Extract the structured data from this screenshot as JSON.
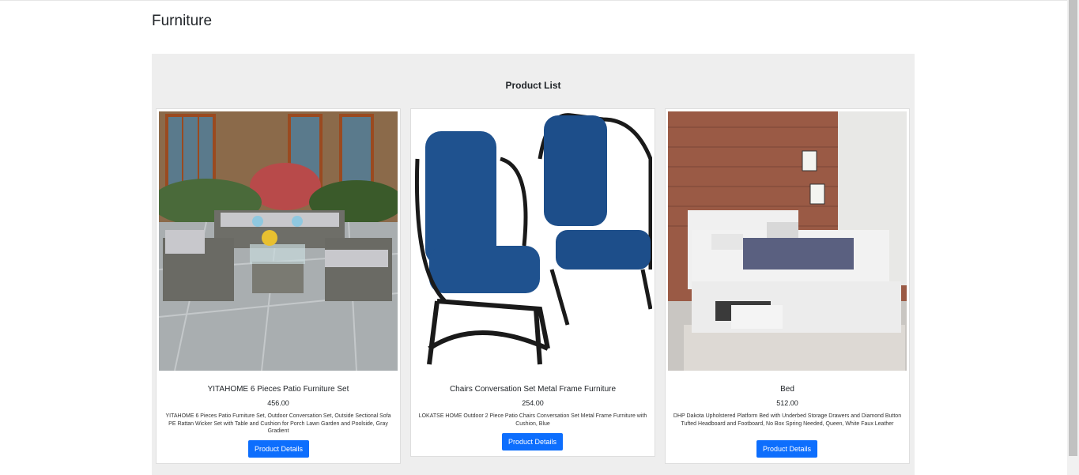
{
  "page": {
    "title": "Furniture"
  },
  "panel": {
    "title": "Product List"
  },
  "products": [
    {
      "name": "YITAHOME 6 Pieces Patio Furniture Set",
      "price": "456.00",
      "description": "YITAHOME 6 Pieces Patio Furniture Set, Outdoor Conversation Set, Outside Sectional Sofa PE Rattan Wicker Set with Table and Cushion for Porch Lawn Garden and Poolside, Gray Gradient",
      "button_label": "Product Details",
      "image": "patio-furniture-image"
    },
    {
      "name": "Chairs Conversation Set Metal Frame Furniture",
      "price": "254.00",
      "description": "LOKATSE HOME Outdoor 2 Piece Patio Chairs Conversation Set Metal Frame Furniture with Cushion, Blue",
      "button_label": "Product Details",
      "image": "blue-rocking-chairs-image"
    },
    {
      "name": "Bed",
      "price": "512.00",
      "description": "DHP Dakota Upholstered Platform Bed with Underbed Storage Drawers and Diamond Button Tufted Headboard and Footboard, No Box Spring Needed, Queen, White Faux Leather",
      "button_label": "Product Details",
      "image": "white-bed-image"
    }
  ],
  "colors": {
    "button": "#0d6efd",
    "panel_bg": "#eeeeee"
  }
}
